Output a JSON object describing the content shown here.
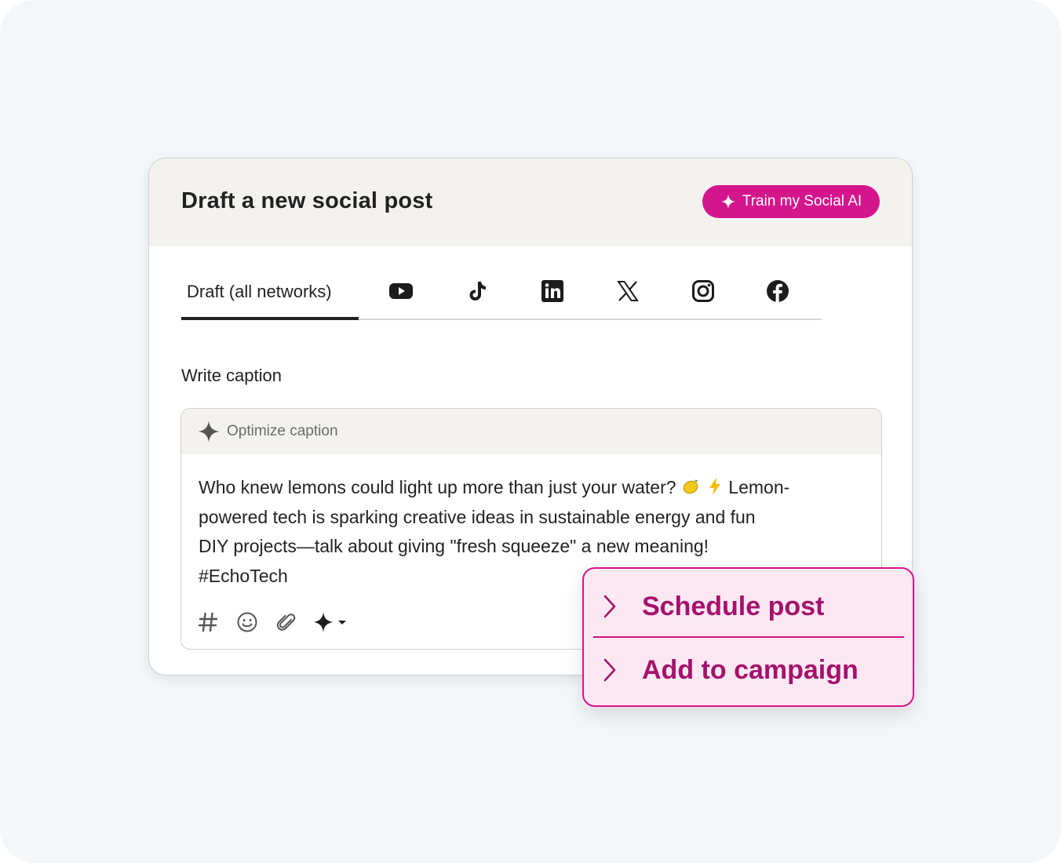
{
  "card": {
    "title": "Draft a new social post",
    "train_button": "Train my Social AI"
  },
  "tabs": {
    "active_label": "Draft (all networks)",
    "networks": [
      "youtube-icon",
      "tiktok-icon",
      "linkedin-icon",
      "x-icon",
      "instagram-icon",
      "facebook-icon"
    ]
  },
  "caption": {
    "section_label": "Write caption",
    "optimize_label": "Optimize caption",
    "text_line1_a": "Who knew lemons could light up more than just your water? ",
    "text_line1_b": " Lemon-",
    "text_rest": "powered tech is sparking creative ideas in sustainable energy and fun\nDIY projects—talk about giving \"fresh squeeze\" a new meaning!\n#EchoTech",
    "toolbar": [
      "hashtag-icon",
      "emoji-icon",
      "attach-icon",
      "ai-assist-icon"
    ]
  },
  "popup": {
    "schedule_label": "Schedule post",
    "campaign_label": "Add to campaign"
  },
  "colors": {
    "accent": "#d4168d",
    "accent_text": "#a5116c",
    "popup_bg": "#fce8f2",
    "header_bg": "#f4f2ef",
    "canvas_bg": "#f4f7fa"
  }
}
